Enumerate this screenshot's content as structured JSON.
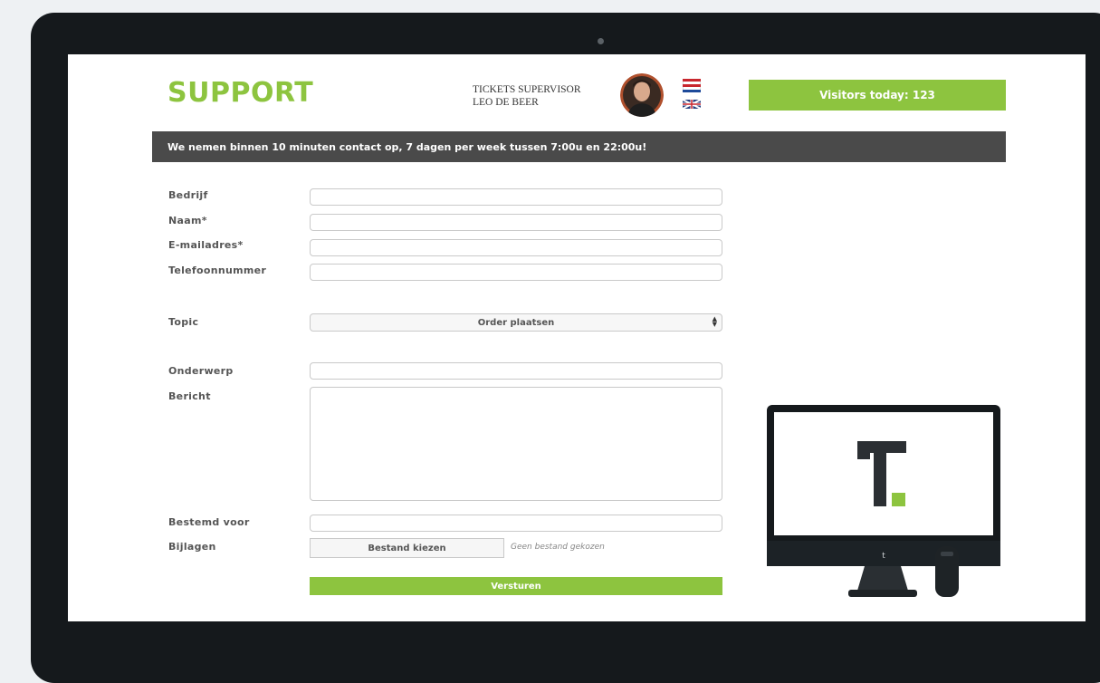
{
  "header": {
    "logo": "SUPPORT",
    "supervisor_title": "TICKETS SUPERVISOR",
    "supervisor_name": "LEO DE BEER",
    "visitors_label": "Visitors today: 123"
  },
  "banner": {
    "text": "We nemen binnen 10 minuten contact op, 7 dagen per week tussen 7:00u en 22:00u!"
  },
  "form": {
    "labels": {
      "company": "Bedrijf",
      "name": "Naam*",
      "email": "E-mailadres*",
      "phone": "Telefoonnummer",
      "topic": "Topic",
      "subject": "Onderwerp",
      "message": "Bericht",
      "intended_for": "Bestemd voor",
      "attachments": "Bijlagen"
    },
    "topic_selected": "Order plaatsen",
    "file_button": "Bestand kiezen",
    "file_status": "Geen bestand gekozen",
    "submit": "Versturen"
  },
  "colors": {
    "accent": "#8dc43f",
    "banner": "#4a4a4a",
    "frame": "#15191c"
  },
  "icons": {
    "avatar": "avatar",
    "flag_nl": "flag-nl-icon",
    "flag_uk": "flag-uk-icon",
    "brand_mark": "brand-t-logo"
  }
}
